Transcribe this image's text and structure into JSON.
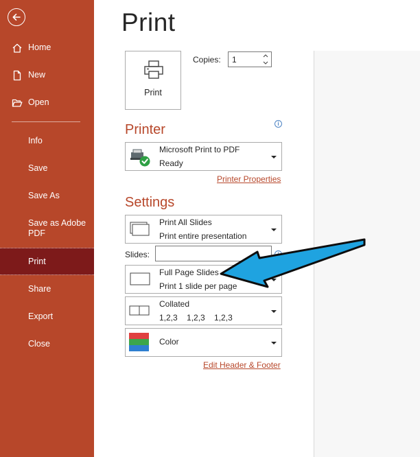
{
  "nav": {
    "items": [
      {
        "label": "Home",
        "icon": "home-icon"
      },
      {
        "label": "New",
        "icon": "new-document-icon"
      },
      {
        "label": "Open",
        "icon": "open-folder-icon"
      },
      {
        "label": "Info"
      },
      {
        "label": "Save"
      },
      {
        "label": "Save As"
      },
      {
        "label": "Save as Adobe PDF"
      },
      {
        "label": "Print",
        "selected": true
      },
      {
        "label": "Share"
      },
      {
        "label": "Export"
      },
      {
        "label": "Close"
      }
    ],
    "back_icon": "back-arrow-icon",
    "background_color": "#b7472a",
    "selected_color": "#7d1a1a"
  },
  "page": {
    "title": "Print"
  },
  "print_button": {
    "label": "Print",
    "icon": "printer-icon"
  },
  "copies": {
    "label": "Copies:",
    "value": "1"
  },
  "printer": {
    "heading": "Printer",
    "name": "Microsoft Print to PDF",
    "status": "Ready",
    "properties_link": "Printer Properties",
    "icon": "printer-ready-icon"
  },
  "settings": {
    "heading": "Settings",
    "range": {
      "title": "Print All Slides",
      "subtitle": "Print entire presentation",
      "icon": "slides-stack-icon"
    },
    "slides_label": "Slides:",
    "slides_value": "",
    "layout": {
      "title": "Full Page Slides",
      "subtitle": "Print 1 slide per page",
      "icon": "full-page-slide-icon"
    },
    "collation": {
      "title": "Collated",
      "subtitle": "1,2,3    1,2,3    1,2,3",
      "icon": "collated-icon"
    },
    "color": {
      "title": "Color",
      "icon": "color-swatch-icon"
    },
    "header_footer_link": "Edit Header & Footer"
  },
  "colors": {
    "accent": "#b7472a",
    "annotation_arrow": "#1fa3e0",
    "info_icon": "#4e84c4"
  }
}
